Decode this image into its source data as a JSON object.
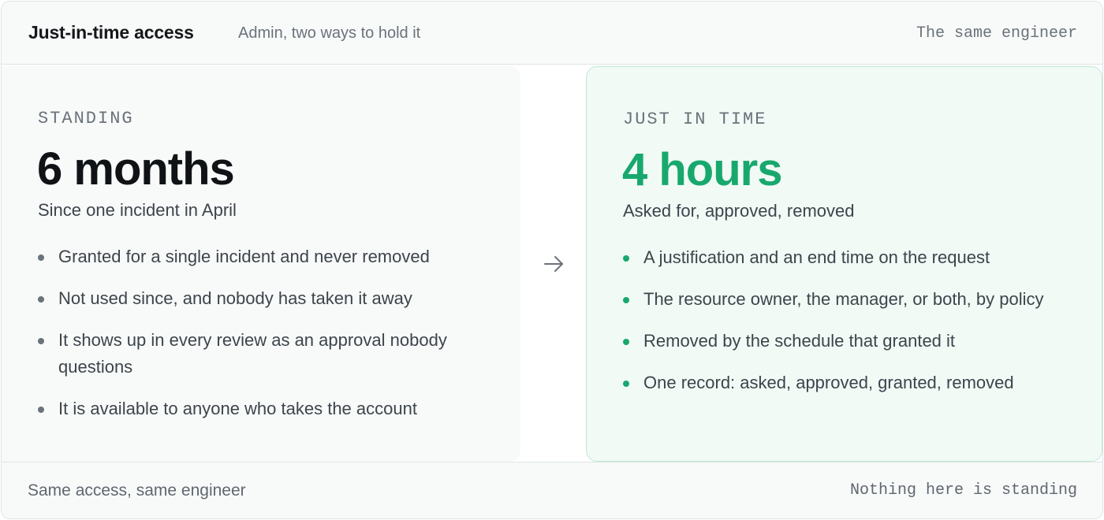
{
  "header": {
    "title": "Just-in-time access",
    "subtitle": "Admin, two ways to hold it",
    "right_note": "The same engineer"
  },
  "standing": {
    "label": "STANDING",
    "duration": "6 months",
    "caption": "Since one incident in April",
    "items": [
      "Granted for a single incident and never removed",
      "Not used since, and nobody has taken it away",
      "It shows up in every review as an approval nobody questions",
      "It is available to anyone who takes the account"
    ]
  },
  "jit": {
    "label": "JUST IN TIME",
    "duration": "4 hours",
    "caption": "Asked for, approved, removed",
    "items": [
      "A justification and an end time on the request",
      "The resource owner, the manager, or both, by policy",
      "Removed by the schedule that granted it",
      "One record: asked, approved, granted, removed"
    ]
  },
  "footer": {
    "left_note": "Same access, same engineer",
    "right_note": "Nothing here is standing"
  },
  "colors": {
    "accent_green": "#18a86e",
    "panel_green_bg": "#f1faf5",
    "panel_green_border": "#bfe8d3"
  },
  "icons": {
    "transition": "arrow-right-icon"
  }
}
